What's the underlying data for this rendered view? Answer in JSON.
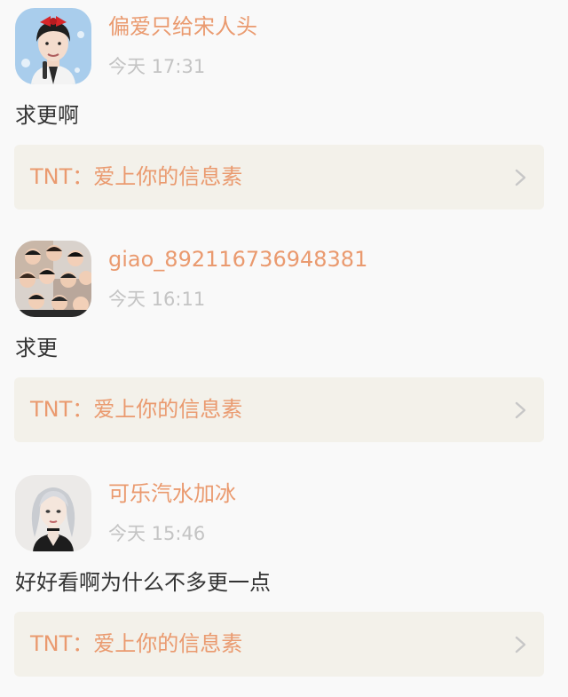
{
  "comments": [
    {
      "username": "偏爱只给宋人头",
      "time": "今天 17:31",
      "text": "求更啊",
      "book": "TNT：爱上你的信息素",
      "avatar_icon": "avatar-boy-red-bow"
    },
    {
      "username": "giao_892116736948381",
      "time": "今天 16:11",
      "text": "求更",
      "book": "TNT：爱上你的信息素",
      "avatar_icon": "avatar-group-photo"
    },
    {
      "username": "可乐汽水加冰",
      "time": "今天 15:46",
      "text": "好好看啊为什么不多更一点",
      "book": "TNT：爱上你的信息素",
      "avatar_icon": "avatar-silver-hair-girl"
    }
  ],
  "colors": {
    "background": "#f9f9f9",
    "username": "#ea9a6f",
    "book_title": "#ea9a6f",
    "time": "#c4c4c4",
    "text": "#333333",
    "card_bg": "#f3f1ea",
    "chevron": "#c7c7c7"
  }
}
